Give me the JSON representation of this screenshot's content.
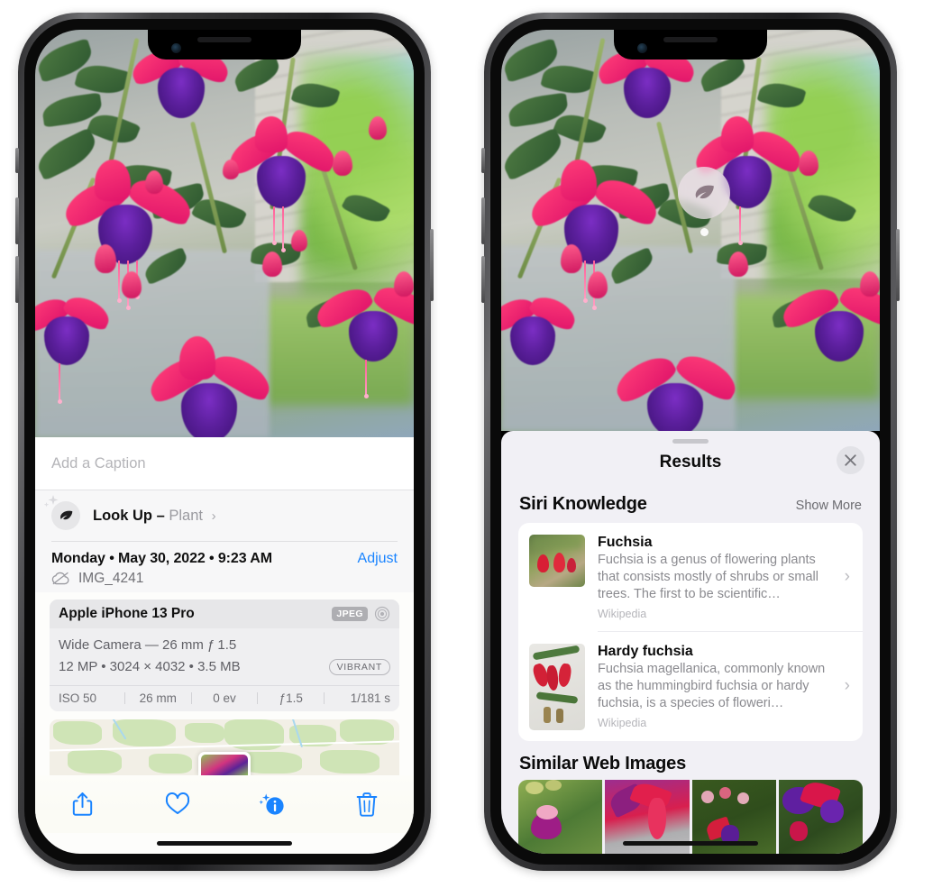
{
  "meta": {
    "description": "Two iPhone screenshots side by side showing Photos app Look Up / Visual Look Up results for a fuchsia plant",
    "accent_blue": "#1a84ff",
    "sheet_bg": "#f1f0f5"
  },
  "left_phone": {
    "caption_field": {
      "placeholder": "Add a Caption",
      "value": ""
    },
    "lookup_row": {
      "icon": "leaf-icon",
      "label": "Look Up",
      "dash": "–",
      "subject": "Plant",
      "chevron": "›"
    },
    "photo_meta": {
      "date": "Monday • May 30, 2022 • 9:23 AM",
      "adjust_label": "Adjust",
      "filename": "IMG_4241",
      "cloud_icon": "icloud-slash-icon"
    },
    "camera_card": {
      "device": "Apple iPhone 13 Pro",
      "format_badge": "JPEG",
      "aperture_icon": "aperture-icon",
      "lens_line": "Wide Camera — 26 mm ƒ 1.5",
      "size_line": "12 MP • 3024 × 4032 • 3.5 MB",
      "style_badge": "VIBRANT",
      "exif": [
        "ISO 50",
        "26 mm",
        "0 ev",
        "ƒ1.5",
        "1/181 s"
      ]
    },
    "toolbar": [
      {
        "name": "share-button",
        "icon": "share-icon"
      },
      {
        "name": "favorite-button",
        "icon": "heart-icon"
      },
      {
        "name": "info-button",
        "icon": "info-sparkle-icon"
      },
      {
        "name": "delete-button",
        "icon": "trash-icon"
      }
    ]
  },
  "right_phone": {
    "badge": {
      "icon": "leaf-icon"
    },
    "sheet": {
      "title": "Results",
      "close_icon": "close-icon",
      "siri_section": {
        "title": "Siri Knowledge",
        "show_more": "Show More",
        "items": [
          {
            "title": "Fuchsia",
            "description": "Fuchsia is a genus of flowering plants that consists mostly of shrubs or small trees. The first to be scientific…",
            "source": "Wikipedia",
            "chevron": "›"
          },
          {
            "title": "Hardy fuchsia",
            "description": "Fuchsia magellanica, commonly known as the hummingbird fuchsia or hardy fuchsia, is a species of floweri…",
            "source": "Wikipedia",
            "chevron": "›"
          }
        ]
      },
      "similar_section": {
        "title": "Similar Web Images",
        "thumbnails": [
          "web-image-1",
          "web-image-2",
          "web-image-3",
          "web-image-4"
        ]
      }
    }
  }
}
